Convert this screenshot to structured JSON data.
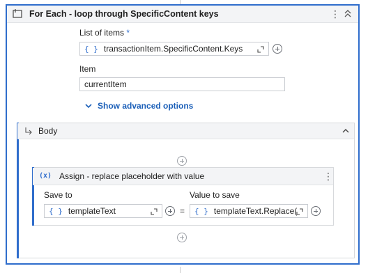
{
  "foreach": {
    "title": "For Each - loop through SpecificContent keys",
    "list_label": "List of items",
    "list_required_mark": "*",
    "list_value": "transactionItem.SpecificContent.Keys",
    "item_label": "Item",
    "item_value": "currentItem",
    "advanced_label": "Show advanced options"
  },
  "body": {
    "title": "Body"
  },
  "assign": {
    "title": "Assign - replace placeholder with value",
    "save_to_label": "Save to",
    "save_to_value": "templateText",
    "value_label": "Value to save",
    "value_value": "templateText.Replace(",
    "equals": "=",
    "icon_text": "(x)"
  },
  "expression_braces": "{ }",
  "colors": {
    "accent": "#2f6dcc",
    "link": "#1b5fb8",
    "header_bg": "#f3f4f6"
  },
  "icons": [
    "sequence-icon",
    "kebab-menu-icon",
    "collapse-all-icon",
    "expand-editor-icon",
    "add-circle-icon",
    "chevron-down-icon",
    "return-arrow-icon",
    "chevron-up-icon",
    "variable-icon"
  ]
}
